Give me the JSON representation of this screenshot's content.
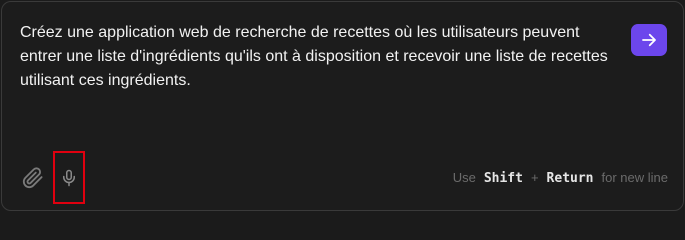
{
  "prompt": {
    "text": "Créez une application web de recherche de recettes où les utilisateurs peuvent entrer une liste d'ingrédients qu'ils ont à disposition et recevoir une liste de recettes utilisant ces ingrédients."
  },
  "actions": {
    "send_icon": "arrow-right-icon",
    "attach_icon": "paperclip-icon",
    "mic_icon": "microphone-icon"
  },
  "hint": {
    "prefix": "Use",
    "key1": "Shift",
    "plus": "+",
    "key2": "Return",
    "suffix": "for new line"
  },
  "colors": {
    "accent": "#6c46ec",
    "highlight_box": "#e0000f",
    "background": "#1c1c1c"
  }
}
